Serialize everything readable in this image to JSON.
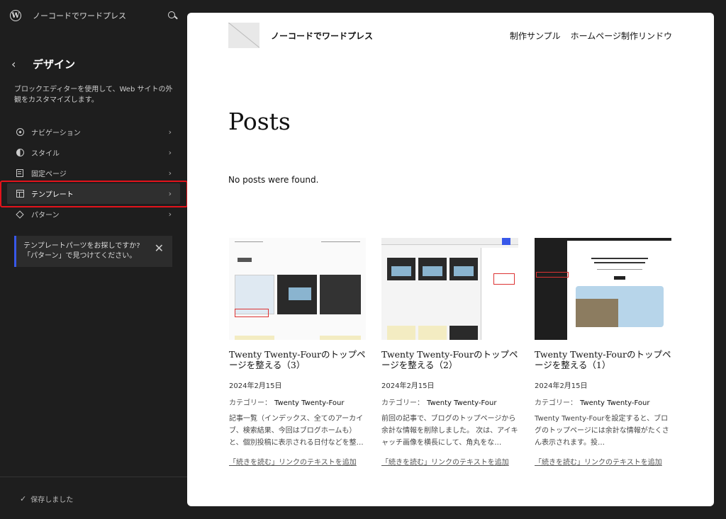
{
  "topbar": {
    "site_name": "ノーコードでワードプレス"
  },
  "section": {
    "title": "デザイン",
    "description": "ブロックエディターを使用して、Web サイトの外観をカスタマイズします。"
  },
  "nav": {
    "items": [
      {
        "label": "ナビゲーション",
        "icon": "compass-icon"
      },
      {
        "label": "スタイル",
        "icon": "half-circle-icon"
      },
      {
        "label": "固定ページ",
        "icon": "page-icon"
      },
      {
        "label": "テンプレート",
        "icon": "layout-icon"
      },
      {
        "label": "パターン",
        "icon": "diamond-icon"
      }
    ]
  },
  "notice": {
    "text": "テンプレートパーツをお探しですか? 「パターン」で見つけてください。"
  },
  "footer": {
    "saved": "保存しました"
  },
  "canvas": {
    "site_title": "ノーコードでワードプレス",
    "nav": [
      "制作サンプル",
      "ホームページ制作リンドウ"
    ],
    "page_title": "Posts",
    "no_posts": "No posts were found.",
    "cards": [
      {
        "title": "Twenty Twenty-Fourのトップページを整える（3）",
        "date": "2024年2月15日",
        "category_label": "カテゴリー：",
        "category": "Twenty Twenty-Four",
        "excerpt": "記事一覧（インデックス、全てのアーカイブ、検索結果、今回はブログホームも）と、個別投稿に表示される日付などを整…",
        "more": "「続きを読む」リンクのテキストを追加"
      },
      {
        "title": "Twenty Twenty-Fourのトップページを整える（2）",
        "date": "2024年2月15日",
        "category_label": "カテゴリー：",
        "category": "Twenty Twenty-Four",
        "excerpt": "前回の記事で、ブログのトップページから余計な情報を削除しました。 次は、アイキャッチ画像を横長にして、角丸をな…",
        "more": "「続きを読む」リンクのテキストを追加"
      },
      {
        "title": "Twenty Twenty-Fourのトップページを整える（1）",
        "date": "2024年2月15日",
        "category_label": "カテゴリー：",
        "category": "Twenty Twenty-Four",
        "excerpt": "Twenty Twenty-Fourを設定すると、ブログのトップページには余計な情報がたくさん表示されます。投…",
        "more": "「続きを読む」リンクのテキストを追加"
      }
    ]
  },
  "colors": {
    "sidebar_bg": "#1e1e1e",
    "highlight": "#e3131b",
    "notice_accent": "#3858e9"
  }
}
